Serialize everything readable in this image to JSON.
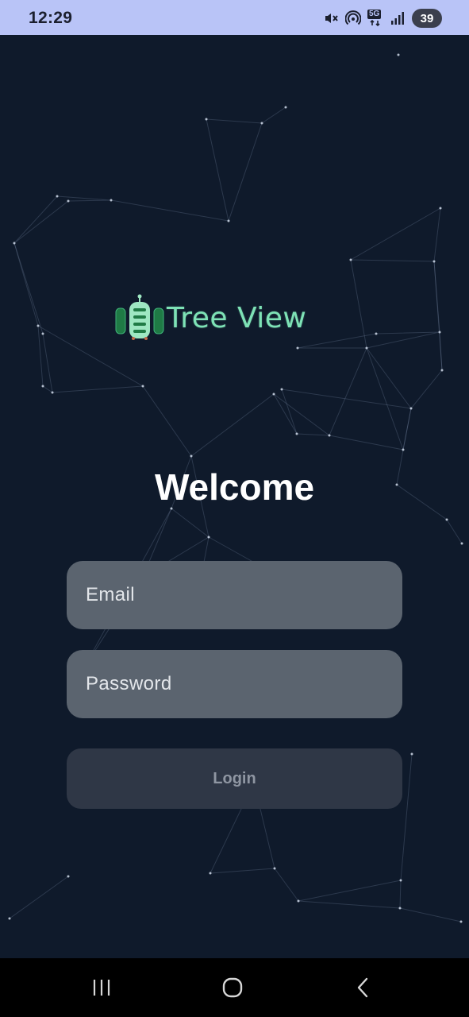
{
  "status_bar": {
    "time": "12:29",
    "network_label": "5G",
    "battery_level": "39",
    "icons": [
      "mute-icon",
      "hotspot-icon",
      "5g-data-icon",
      "signal-icon",
      "battery-icon"
    ]
  },
  "logo": {
    "text": "Tree View",
    "colors": {
      "text": "#7ee2b6",
      "mark_dark": "#1f7a45",
      "mark_light": "#9ee7c2"
    }
  },
  "welcome": {
    "title": "Welcome"
  },
  "form": {
    "email_placeholder": "Email",
    "password_placeholder": "Password",
    "login_label": "Login"
  },
  "nav_bar": {
    "icons": [
      "recent-apps-icon",
      "home-icon",
      "back-icon"
    ]
  },
  "colors": {
    "background": "#0f1a2b",
    "status_bar": "#b9c4f7",
    "field_bg": "#5b646f",
    "button_bg": "#2f3746"
  }
}
